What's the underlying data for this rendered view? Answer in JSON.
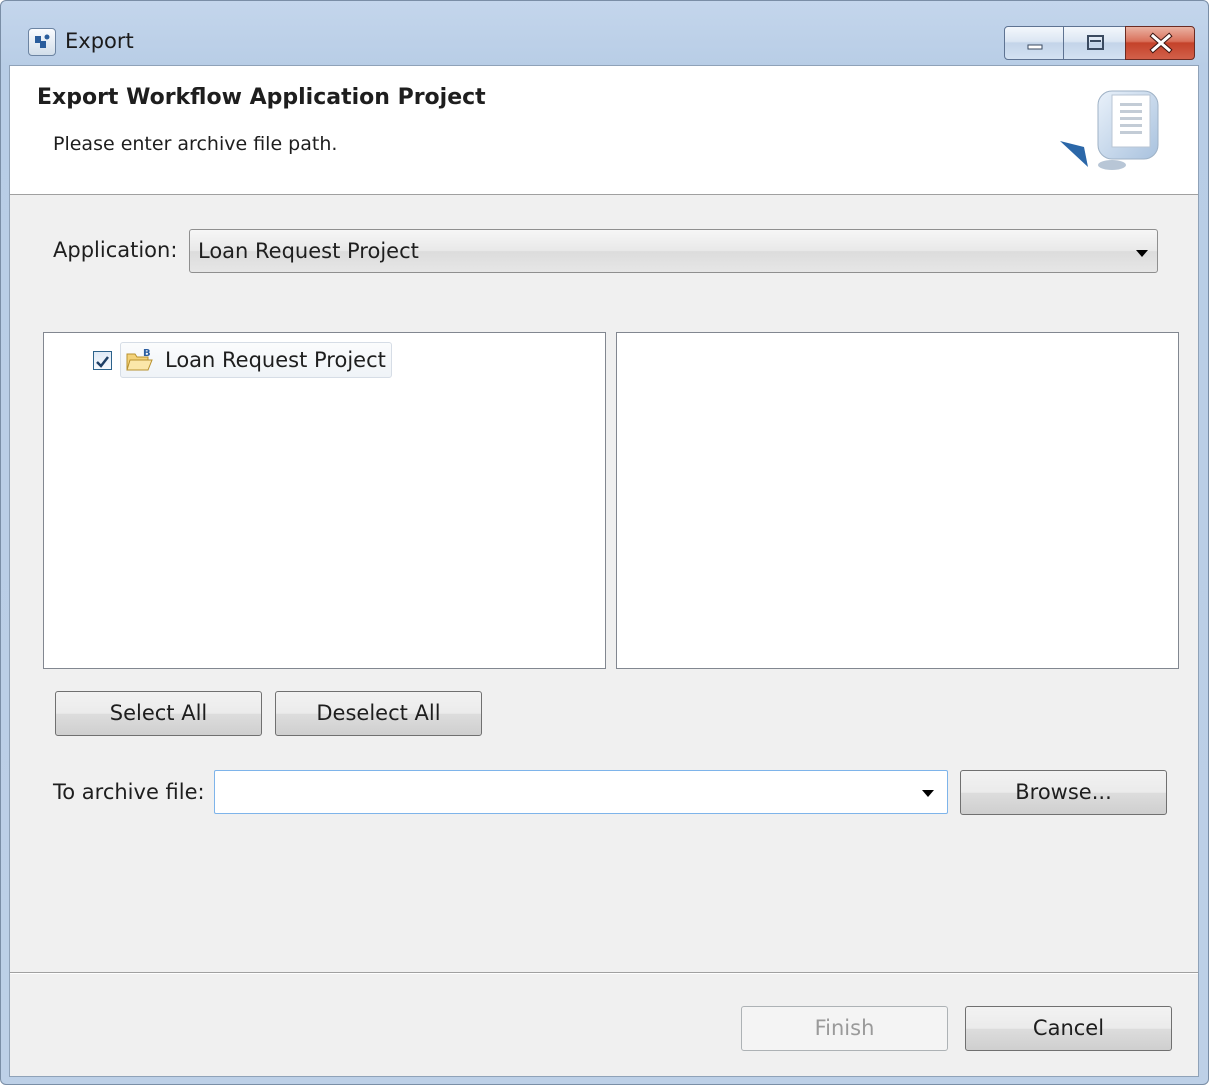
{
  "window": {
    "title": "Export",
    "controls": {
      "minimize": "minimize",
      "maximize": "maximize",
      "close": "close"
    }
  },
  "banner": {
    "title": "Export Workflow Application Project",
    "description": "Please enter archive file path."
  },
  "application": {
    "label": "Application:",
    "selected": "Loan Request Project"
  },
  "tree": {
    "items": [
      {
        "label": "Loan Request Project",
        "checked": true
      }
    ]
  },
  "buttons": {
    "select_all": "Select All",
    "deselect_all": "Deselect All",
    "browse": "Browse...",
    "finish": "Finish",
    "cancel": "Cancel"
  },
  "archive": {
    "label": "To archive file:",
    "value": ""
  },
  "colors": {
    "titlebar": "#bdd0e7",
    "close_button": "#c4422a",
    "dialog_bg": "#f0f0f0",
    "focus_border": "#7eb4ea"
  }
}
